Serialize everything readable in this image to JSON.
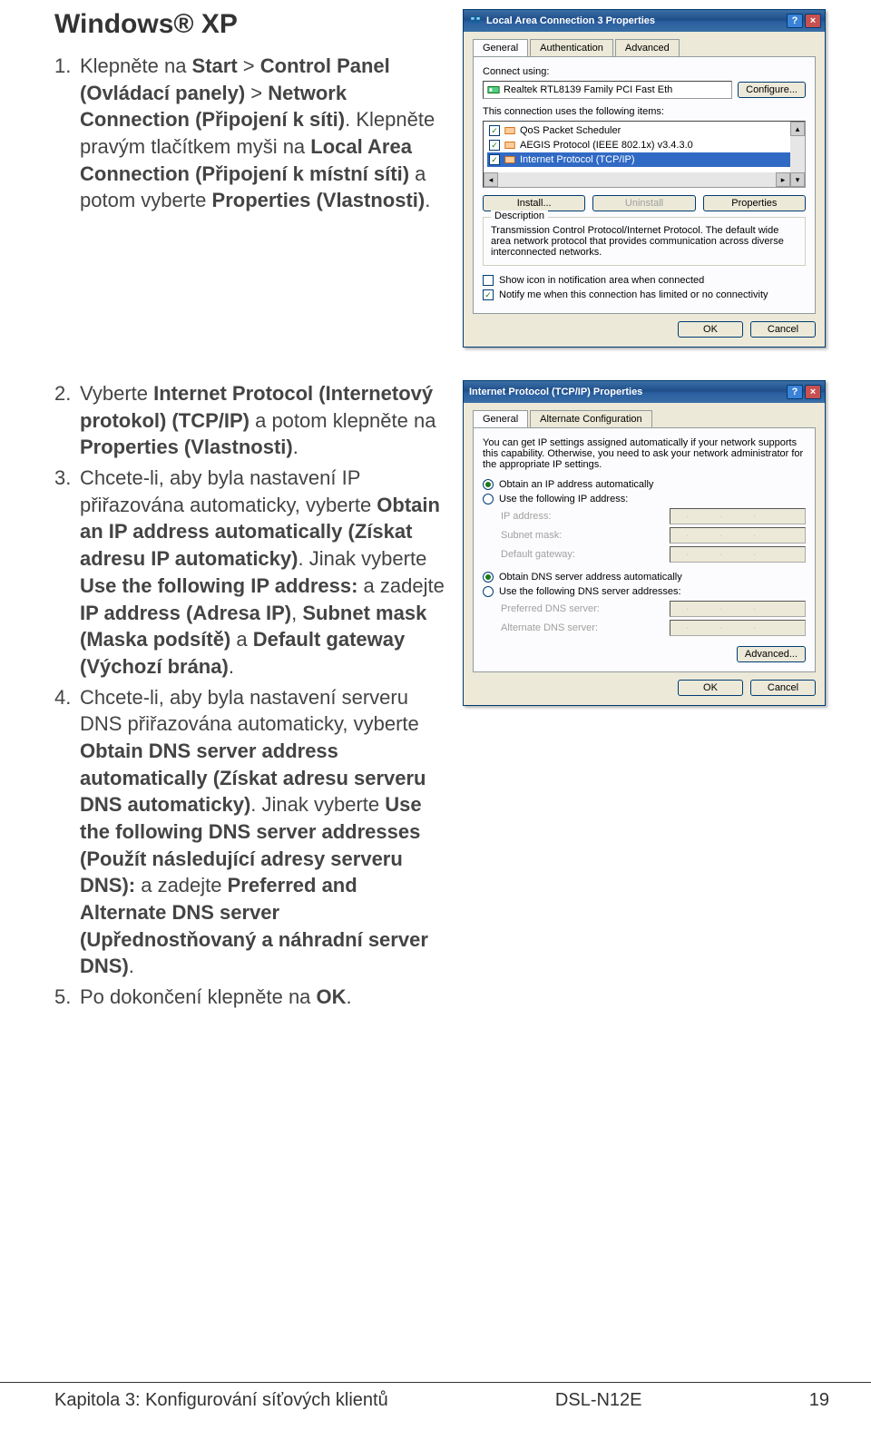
{
  "heading": "Windows® XP",
  "steps": [
    {
      "num": "1.",
      "html": "Klepněte na <b>Start</b> > <b>Control Panel (Ovládací panely)</b> > <b>Network Connection (Připojení k síti)</b>. Klepněte pravým tlačítkem myši na <b>Local Area Connection (Připojení k místní síti)</b> a potom vyberte <b>Properties (Vlastnosti)</b>."
    }
  ],
  "steps2": [
    {
      "num": "2.",
      "html": "Vyberte <b>Internet Protocol (Internetový protokol) (TCP/IP)</b> a potom klepněte na <b>Properties (Vlastnosti)</b>."
    },
    {
      "num": "3.",
      "html": "Chcete-li, aby byla nastavení IP přiřazována automaticky, vyberte <b>Obtain an IP address automatically (Získat adresu IP automaticky)</b>. Jinak vyberte <b>Use the following IP address:</b> a zadejte <b>IP address (Adresa IP)</b>, <b>Subnet mask (Maska podsítě)</b> a <b>Default gateway (Výchozí brána)</b>."
    },
    {
      "num": "4.",
      "html": "Chcete-li, aby byla nastavení serveru DNS přiřazována automaticky, vyberte <b>Obtain DNS server address automatically (Získat adresu serveru DNS automaticky)</b>. Jinak vyberte <b>Use the following DNS server addresses (Použít následující adresy serveru DNS):</b>  a zadejte <b>Preferred and Alternate DNS server (Upřednostňovaný a náhradní server DNS)</b>."
    },
    {
      "num": "5.",
      "html": "Po dokončení klepněte na <b>OK</b>."
    }
  ],
  "dlg1": {
    "title": "Local Area Connection 3 Properties",
    "tabs": [
      "General",
      "Authentication",
      "Advanced"
    ],
    "connectUsing": "Connect using:",
    "adapter": "Realtek RTL8139 Family PCI Fast Eth",
    "configure": "Configure...",
    "itemsLabel": "This connection uses the following items:",
    "items": [
      "QoS Packet Scheduler",
      "AEGIS Protocol (IEEE 802.1x) v3.4.3.0",
      "Internet Protocol (TCP/IP)"
    ],
    "install": "Install...",
    "uninstall": "Uninstall",
    "properties": "Properties",
    "descLabel": "Description",
    "desc": "Transmission Control Protocol/Internet Protocol. The default wide area network protocol that provides communication across diverse interconnected networks.",
    "chk1": "Show icon in notification area when connected",
    "chk2": "Notify me when this connection has limited or no connectivity",
    "ok": "OK",
    "cancel": "Cancel"
  },
  "dlg2": {
    "title": "Internet Protocol (TCP/IP) Properties",
    "tabs": [
      "General",
      "Alternate Configuration"
    ],
    "intro": "You can get IP settings assigned automatically if your network supports this capability. Otherwise, you need to ask your network administrator for the appropriate IP settings.",
    "r1": "Obtain an IP address automatically",
    "r2": "Use the following IP address:",
    "ip": "IP address:",
    "mask": "Subnet mask:",
    "gw": "Default gateway:",
    "r3": "Obtain DNS server address automatically",
    "r4": "Use the following DNS server addresses:",
    "pdns": "Preferred DNS server:",
    "adns": "Alternate DNS server:",
    "adv": "Advanced...",
    "ok": "OK",
    "cancel": "Cancel"
  },
  "footer": {
    "left": "Kapitola 3: Konfigurování síťových klientů",
    "mid": "DSL-N12E",
    "page": "19"
  }
}
